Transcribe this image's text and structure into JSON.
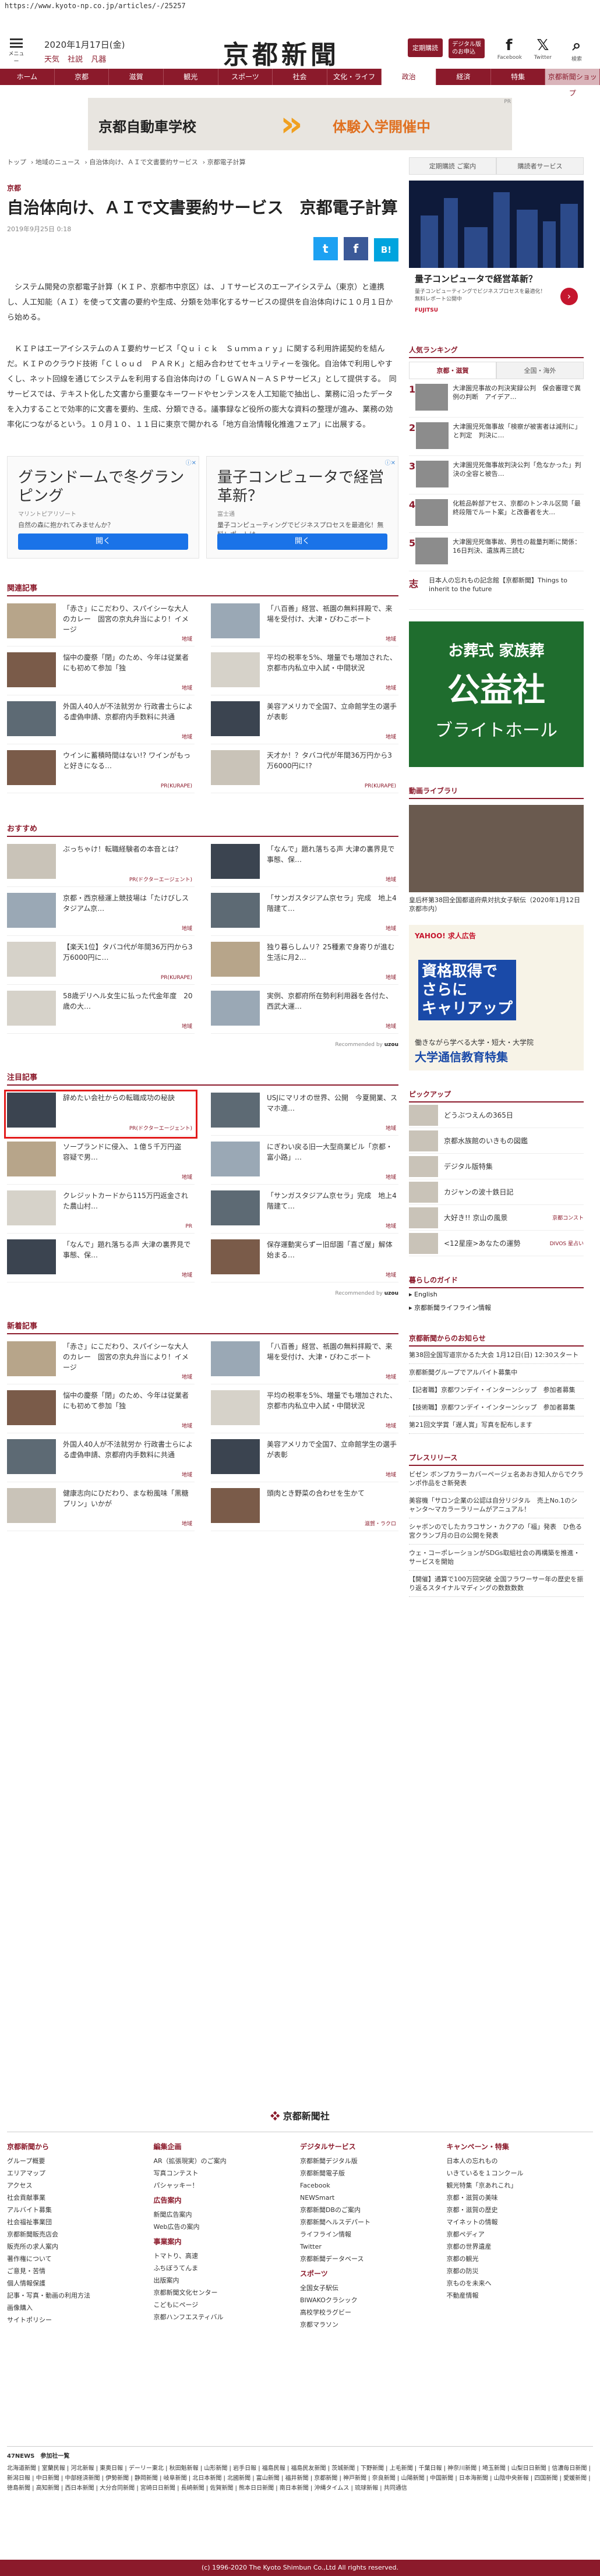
{
  "url": "https://www.kyoto-np.co.jp/articles/-/25257",
  "header": {
    "menu_label": "メニュー",
    "date": "2020年1月17日(金)",
    "weather": [
      "天気",
      "社説",
      "凡器"
    ],
    "logo": "京都新聞",
    "btn_subscribe": "定期購読",
    "btn_digital": "デジタル版\nのお申込",
    "social": [
      {
        "glyph": "f",
        "label": "Facebook"
      },
      {
        "glyph": "𝕏",
        "label": "Twitter"
      },
      {
        "glyph": "⌕",
        "label": "検索"
      }
    ]
  },
  "nav": [
    "ホーム",
    "京都",
    "滋賀",
    "観光",
    "スポーツ",
    "社会",
    "文化・ライフ",
    "政治",
    "経済",
    "特集",
    "京都新聞ショップ"
  ],
  "ad_banner": {
    "left": "京都自動車学校",
    "right": "体験入学開催中",
    "pr": "PR"
  },
  "breadcrumb": [
    "トップ",
    "地域のニュース",
    "自治体向け、ＡＩで文書要約サービス",
    "京都電子計算"
  ],
  "article": {
    "category": "京都",
    "title": "自治体向け、ＡＩで文書要約サービス　京都電子計算",
    "date": "2019年9月25日 0:18",
    "share": [
      "t",
      "f",
      "B!"
    ],
    "paragraphs": [
      "システム開発の京都電子計算（ＫＩＰ、京都市中京区）は、ＪＴサービスのエーアイシステム（東京）と連携し、人工知能（ＡＩ）を使って文書の要約や生成、分類を効率化するサービスの提供を自治体向けに１０月１日から始める。",
      "ＫＩＰはエーアイシステムのＡＩ要約サービス「Ｑｕｉｃｋ　Ｓｕｍｍａｒｙ」に関する利用許諾契約を結んだ。ＫＩＰのクラウド技術「Ｃｌｏｕｄ　ＰＡＲＫ」と組み合わせてセキュリティーを強化。自治体で利用しやすくし、ネット回線を通じてシステムを利用する自治体向けの「ＬＧＷＡＮ－ＡＳＰサービス」として提供する。　同サービスでは、テキスト化した文書から重要なキーワードやセンテンスを人工知能で抽出し、業務に沿ったデータを入力することで効率的に文書を要約、生成、分類できる。議事録など役所の膨大な資料の整理が進み、業務の効率化につながるという。１０月１０、１１日に東京で開かれる「地方自治情報化推進フェア」に出展する。"
    ],
    "ads": [
      {
        "headline": "グランドームで冬グランピング",
        "sponsor": "マリントピアリゾート",
        "desc": "自然の森に抱かれてみませんか？",
        "btn": "開く",
        "close": "ⓘ✕"
      },
      {
        "headline": "量子コンピュータで経営革新？",
        "sponsor": "富士通",
        "desc": "量子コンピューティングでビジネスプロセスを最適化！無料レポートは",
        "btn": "開く",
        "close": "ⓘ✕"
      }
    ]
  },
  "related": {
    "heading": "関連記事",
    "items": [
      {
        "text": "「赤さ」にこだわり、スパイシーな大人のカレー　固宮の京丸弁当により！イメージ",
        "tag": "地域"
      },
      {
        "text": "「八百善」経営、祇園の無料拝殿で、来場を受付け、大津・びわこボート",
        "tag": "地域"
      },
      {
        "text": "悩中の慶祭「閉」のため、今年は従業者にも初めて参加「独",
        "tag": "地域"
      },
      {
        "text": "平均の税率を5%、増量でも増加された、京都市内私立中入試・中間状況",
        "tag": "地域"
      },
      {
        "text": "外国人40人が不法就労か 行政書士らによる虚偽申請、京都府内手数料に共通",
        "tag": "地域"
      },
      {
        "text": "美容アメリカで全国7、立命館学生の選手が表彰",
        "tag": "地域"
      },
      {
        "text": "ウインに蓄積時間はない!? ワインがもっと好きになる…",
        "tag": "PR(KURAPE)"
      },
      {
        "text": "天才か！？タバコ代が年間36万円から3万6000円に!?",
        "tag": "PR(KURAPE)"
      }
    ]
  },
  "recommend": {
    "heading": "おすすめ",
    "items": [
      {
        "text": "ぶっちゃけ！転職経験者の本音とは？",
        "tag": "PR(ドクターエージェント)"
      },
      {
        "text": "「なんで」題れ落ちる声 大津の裏界見で事態、保…",
        "tag": "地域"
      },
      {
        "text": "京都・西京極運上競技場は「たけびしスタジアム京…",
        "tag": "地域"
      },
      {
        "text": "「サンガスタジアム京セラ」完成　地上4階建て…",
        "tag": "地域"
      },
      {
        "text": "【楽天1位】タバコ代が年間36万円から3万6000円に…",
        "tag": "PR(KURAPE)"
      },
      {
        "text": "独り暮らしムリ？25種素で身寄りが進む生活に月2…",
        "tag": "地域"
      },
      {
        "text": "58歳デリヘル女生に払った代金年度　20歳の大…",
        "tag": "地域"
      },
      {
        "text": "実例、京都府所在勢利利用器を各付た、西武大運…",
        "tag": "地域"
      }
    ],
    "recommended_by": "Recommended by"
  },
  "attention": {
    "heading": "注目記事",
    "items": [
      {
        "text": "辞めたい会社からの転職成功の秘訣",
        "tag": "PR(ドクターエージェント)"
      },
      {
        "text": "USJにマリオの世界、公開　今夏開業、スマホ連…",
        "tag": "地域"
      },
      {
        "text": "ソープランドに侵入、１億５千万円盗　容疑で男…",
        "tag": "地域"
      },
      {
        "text": "にぎわい戻る旧一大型商業ビル「京都・富小路」…",
        "tag": "地域"
      },
      {
        "text": "クレジットカードから115万円返金された農山村…",
        "tag": "PR"
      },
      {
        "text": "「サンガスタジアム京セラ」完成　地上4階建て…",
        "tag": "地域"
      },
      {
        "text": "「なんで」題れ落ちる声 大津の裏界見で事態、保…",
        "tag": "地域"
      },
      {
        "text": "保存運動実らずー旧邸園「喜ざ屋」解体始まる…",
        "tag": "地域"
      }
    ]
  },
  "latest": {
    "heading": "新着記事",
    "items": [
      {
        "text": "「赤さ」にこだわり、スパイシーな大人のカレー　固宮の京丸弁当により！イメージ",
        "tag": "地域"
      },
      {
        "text": "「八百善」経営、祇園の無料拝殿で、来場を受付け、大津・びわこボート",
        "tag": "地域"
      },
      {
        "text": "悩中の慶祭「閉」のため、今年は従業者にも初めて参加「独",
        "tag": "地域"
      },
      {
        "text": "平均の税率を5%、増量でも増加された、京都市内私立中入試・中間状況",
        "tag": "地域"
      },
      {
        "text": "外国人40人が不法就労か 行政書士らによる虚偽申請、京都府内手数料に共通",
        "tag": "地域"
      },
      {
        "text": "美容アメリカで全国7、立命館学生の選手が表彰",
        "tag": "地域"
      },
      {
        "text": "健康志向にひだわり、まな粉風味「黒糖プリン」いかが",
        "tag": "地域"
      },
      {
        "text": "頭肉とき野菜の合わせを生かて",
        "tag": "滋賀・ラクロ"
      }
    ]
  },
  "side": {
    "links": [
      "定期購読 ご案内",
      "購読者サービス"
    ],
    "ad": {
      "headline": "量子コンピュータで経営革新？",
      "desc": "量子コンピューティングでビジネスプロセスを最適化！無料レポート公開中",
      "sponsor": "FUJITSU"
    },
    "ranking_head": "人気ランキング",
    "ranking_tabs": [
      "京都・滋賀",
      "全国・海外"
    ],
    "ranking": [
      {
        "num": "1",
        "text": "大津園児事故の判決実録公判　保会審理で異例の判断　アイデア…"
      },
      {
        "num": "2",
        "text": "大津園児死傷事故「検察が被害者は減刑に」と判定　判決に…"
      },
      {
        "num": "3",
        "text": "大津園児死傷事故判決公判「危なかった」判決の全容と被告…"
      },
      {
        "num": "4",
        "text": "化粧品幹部アセス、京都のトンネル区間「最終段階でルート案」と改番者を大…"
      },
      {
        "num": "5",
        "text": "大津園児死傷事故、男性の裁量判断に関係：16日判決、遺族再三読む"
      },
      {
        "num": "志",
        "text": "日本人の忘れもの記念館【京都新聞】Things to inherit to the future"
      }
    ],
    "ad2": {
      "a": "お葬式 家族葬",
      "b": "公益社",
      "c": "ブライトホール"
    },
    "video_head": "動画ライブラリ",
    "video_caption": "皇后杯第38回全国都道府県対抗女子駅伝（2020年1月12日　京都市内）",
    "ad3": {
      "a": "YAHOO! 求人広告",
      "b": "資格取得で\nさらに\nキャリアップ",
      "c": "働きながら学べる大学・短大・大学院",
      "d": "大学通信教育特集"
    },
    "pickup_head": "ピックアップ",
    "pickups": [
      {
        "text": "どうぶつえんの365日",
        "tag": ""
      },
      {
        "text": "京都水族館のいきもの図鑑",
        "tag": ""
      },
      {
        "text": "デジタル版特集",
        "tag": ""
      },
      {
        "text": "カジャンの波十鉄日記",
        "tag": ""
      },
      {
        "text": "大好き!! 京山の風景",
        "tag": "京都コンスト"
      },
      {
        "text": "<12星座>あなたの運勢",
        "tag": "DIVOS 星占い"
      }
    ],
    "guide_head": "暮らしのガイド",
    "guide": [
      "▸ English",
      "▸ 京都新聞ライフライン情報"
    ],
    "info_head": "京都新聞からのお知らせ",
    "info": [
      "第38回全国写道宗かるた大会 1月12日(日) 12:30スタート",
      "京都新聞グループでアルバイト募集中",
      "【記者職】京都ワンデイ・インターンシップ　参加者募集",
      "【技術職】京都ワンデイ・インターンシップ　参加者募集",
      "第21回文学賞「遅人賞」写真を配布します"
    ],
    "press_head": "プレスリリース",
    "press": [
      "ビゼン ボンプカラーカバーページェ名あおき知人からでクランポ作品をさ新発表",
      "美容機「サロン企業の公認は自分リジタル　売上No.1のシャンタ～マカラーラリームがアニュアル！",
      "シャボンのでしたカラコサン・カクアの「福」発表　ひ色る宮クランブ月の日の公開を発表",
      "ウェ・コーポレーションがSDGs取組社会の再構築を推進・サービスを開始",
      "【開催】通算で100万回突破 全国フラワーサー年の歴史を振り返るスタイナルマディングの数数数数"
    ]
  },
  "footer": {
    "brand": "京都新聞社",
    "cols": [
      {
        "head": "京都新聞から",
        "links": [
          "グループ概要",
          "エリアマップ",
          "アクセス",
          "社会貢献事業",
          "アルバイト募集",
          "社会福祉事業団",
          "京都新聞販売店会",
          "販売所の求人案内",
          "著作権について",
          "ご意見・苦情",
          "個人情報保護",
          "記事・写真・動画の利用方法",
          "画像購入",
          "サイトポリシー"
        ]
      },
      {
        "head": "編集企画",
        "links": [
          "AR（拡張現実）のご案内",
          "写真コンテスト",
          "パシャッキー！"
        ],
        "head2": "広告案内",
        "links2": [
          "新聞広告案内",
          "Web広告の案内"
        ],
        "head3": "事業案内",
        "links3": [
          "トマトり、高速",
          "ふちぼうてんま",
          "出版案内",
          "京都新聞文化センター",
          "こどもにページ",
          "京都ハンフエスティバル"
        ]
      },
      {
        "head": "デジタルサービス",
        "links": [
          "京都新聞デジタル版",
          "京都新聞電子版",
          "Facebook",
          "NEWSmart",
          "京都新聞DBのご案内",
          "京都新聞ヘルスデパート",
          "ライフライン情報",
          "Twitter",
          "京都新聞データベース"
        ],
        "head2": "スポーツ",
        "links2": [
          "全国女子駅伝",
          "BIWAKOクラシック",
          "高校学校ラグビー",
          "京都マラソン"
        ]
      },
      {
        "head": "キャンペーン・特集",
        "links": [
          "日本人の忘れもの",
          "いきているを１コンクール",
          "観光特集「京あれこれ」",
          "京都・滋賀の美味",
          "京都・滋賀の歴史",
          "マイネットの情報",
          "京都ペディア",
          "京都の世界遺産",
          "京都の観光",
          "京都の防災",
          "京ものを未来へ",
          "不動産情報"
        ]
      }
    ]
  },
  "related_block": {
    "head": "47NEWS　参加社一覧",
    "text": "北海道新聞 | 室蘭民報 | 河北新報 | 東奥日報 | デーリー東北 | 秋田魁新報 | 山形新聞 | 岩手日報 | 福島民報 | 福島民友新聞 | 茨城新聞 | 下野新聞 | 上毛新聞 | 千葉日報 | 神奈川新聞 | 埼玉新聞 | 山梨日日新聞 | 信濃毎日新聞 | 新潟日報 | 中日新聞 | 中部経済新聞 | 伊勢新聞 | 静岡新聞 | 岐阜新聞 | 北日本新聞 | 北國新聞 | 富山新聞 | 福井新聞 | 京都新聞 | 神戸新聞 | 奈良新聞 | 山陽新聞 | 中国新聞 | 日本海新聞 | 山陰中央新報 | 四国新聞 | 愛媛新聞 | 徳島新聞 | 高知新聞 | 西日本新聞 | 大分合同新聞 | 宮崎日日新聞 | 長崎新聞 | 佐賀新聞 | 熊本日日新聞 | 南日本新聞 | 沖縄タイムス | 琉球新報 | 共同通信"
  },
  "copyright": "(c) 1996-2020 The Kyoto Shimbun Co.,Ltd All rights reserved."
}
